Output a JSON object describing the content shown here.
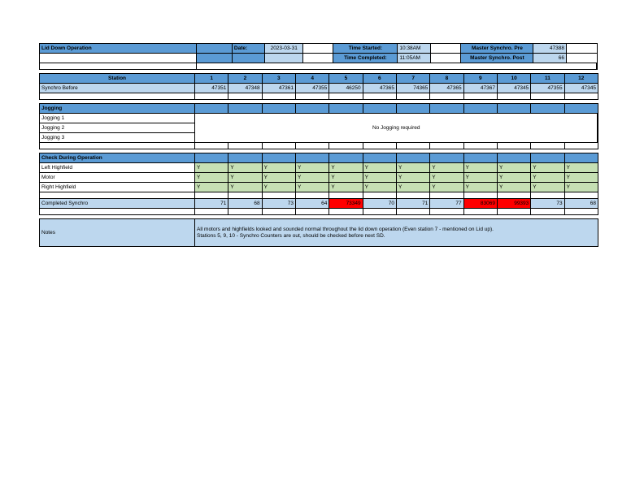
{
  "document": {
    "title": "Lid Down Operation"
  },
  "colors": {
    "header_blue": "#5B9BD5",
    "light_blue": "#BDD7EE",
    "green": "#C6E0B4",
    "alert_red": "#FF0000",
    "white": "#FFFFFF",
    "border": "#000000"
  },
  "header": {
    "operation_title": "Lid Down Operation",
    "date_label": "Date:",
    "date_value": "2023-03-31",
    "time_started_label": "Time Started:",
    "time_started_value": "10:38AM",
    "time_completed_label": "Time Completed:",
    "time_completed_value": "11:05AM",
    "master_synchro_pre_label": "Master Synchro. Pre",
    "master_synchro_pre_value": "47388",
    "master_synchro_post_label": "Master Synchro. Post",
    "master_synchro_post_value": "66"
  },
  "station_table": {
    "station_label": "Station",
    "stations": [
      "1",
      "2",
      "3",
      "4",
      "5",
      "6",
      "7",
      "8",
      "9",
      "10",
      "11",
      "12"
    ],
    "synchro_before_label": "Synchro Before",
    "synchro_before": [
      "47351",
      "47348",
      "47361",
      "47355",
      "46250",
      "47365",
      "74365",
      "47365",
      "47367",
      "47345",
      "47355",
      "47345"
    ]
  },
  "jogging": {
    "section_label": "Jogging",
    "rows": [
      "Jogging 1",
      "Jogging 2",
      "Jogging 3"
    ],
    "message": "No Jogging required"
  },
  "check_during_operation": {
    "section_label": "Check During Operation",
    "rows": [
      {
        "label": "Left Highfield",
        "values": [
          "Y",
          "Y",
          "Y",
          "Y",
          "Y",
          "Y",
          "Y",
          "Y",
          "Y",
          "Y",
          "Y",
          "Y"
        ]
      },
      {
        "label": "Motor",
        "values": [
          "Y",
          "Y",
          "Y",
          "Y",
          "Y",
          "Y",
          "Y",
          "Y",
          "Y",
          "Y",
          "Y",
          "Y"
        ]
      },
      {
        "label": "Right Highfield",
        "values": [
          "Y",
          "Y",
          "Y",
          "Y",
          "Y",
          "Y",
          "Y",
          "Y",
          "Y",
          "Y",
          "Y",
          "Y"
        ]
      }
    ]
  },
  "completed_synchro": {
    "label": "Completed Synchro",
    "values": [
      "71",
      "68",
      "73",
      "64",
      "73349",
      "70",
      "71",
      "77",
      "83069",
      "99393",
      "73",
      "68"
    ],
    "alert_indexes": [
      4,
      8,
      9
    ]
  },
  "notes": {
    "label": "Notes",
    "line1": "All motors and highfields looked and sounded normal throughout the lid down operation (Even station 7 - mentioned on Lid up).",
    "line2": "Stations 5, 9, 10 - Synchro Counters are out, should be checked before next SD."
  }
}
